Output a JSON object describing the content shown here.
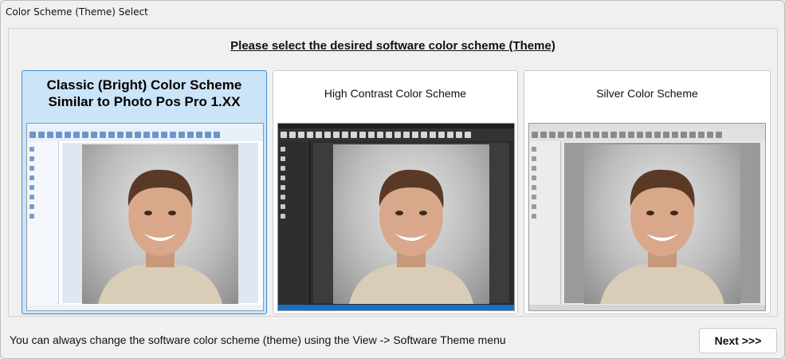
{
  "window": {
    "title": "Color Scheme (Theme) Select"
  },
  "heading": "Please select the desired software color scheme (Theme)",
  "themes": [
    {
      "id": "classic",
      "label_line1": "Classic (Bright) Color Scheme",
      "label_line2": "Similar to Photo Pos Pro 1.XX",
      "selected": true
    },
    {
      "id": "contrast",
      "label": "High Contrast Color Scheme",
      "selected": false
    },
    {
      "id": "silver",
      "label": "Silver Color Scheme",
      "selected": false
    }
  ],
  "footer": {
    "hint": "You can always change the software color scheme (theme) using the View -> Software Theme menu",
    "next_label": "Next >>>"
  },
  "colors": {
    "selected_bg": "#cce4f7",
    "selected_border": "#3c8fd6",
    "status_blue": "#1a6fc2"
  }
}
